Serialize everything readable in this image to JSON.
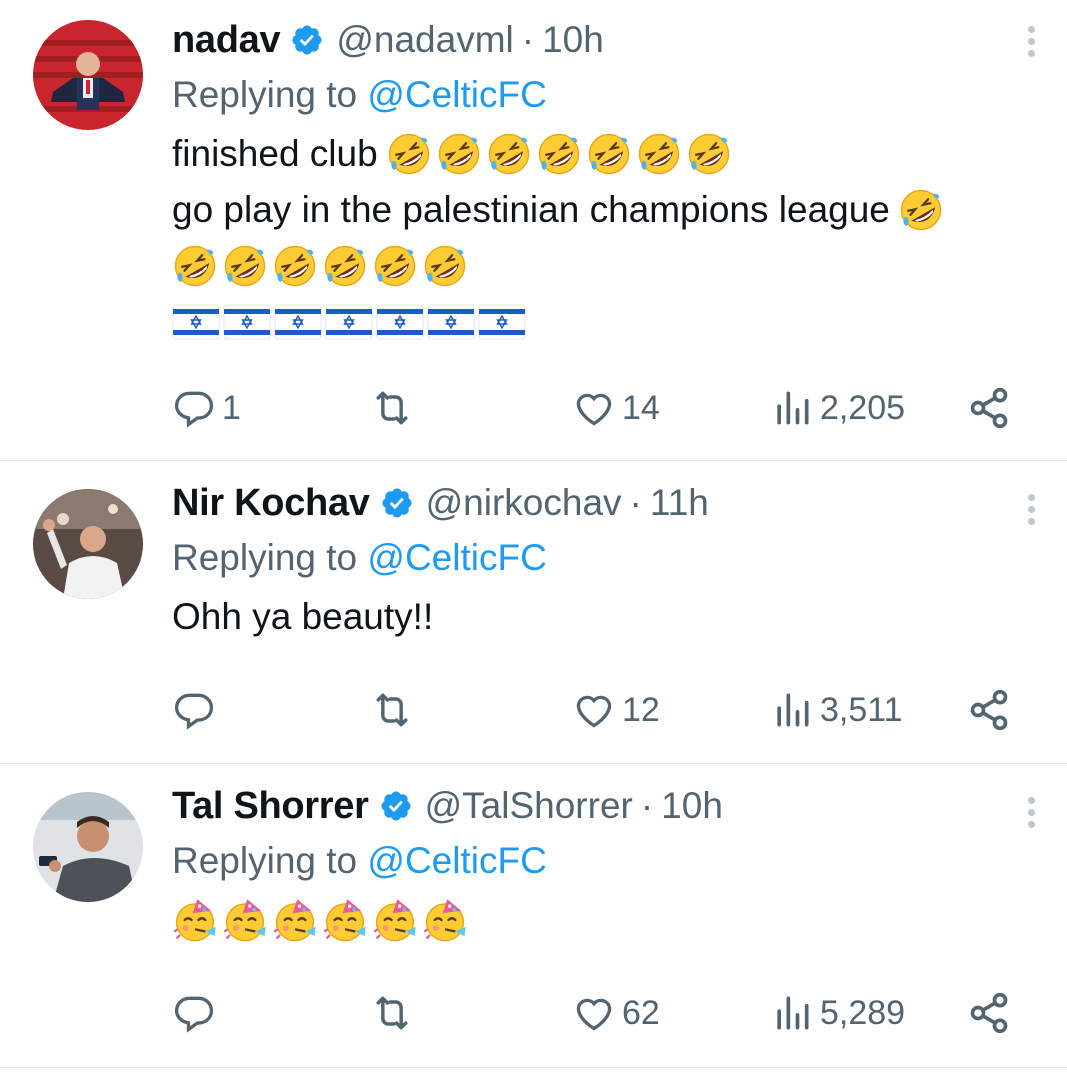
{
  "tweets": [
    {
      "name": "nadav",
      "handle": "@nadavml",
      "separator": "·",
      "time": "10h",
      "reply_prefix": "Replying to",
      "reply_mention": "@CelticFC",
      "text_lines": [
        "finished club",
        "go play in the palestinian champions league"
      ],
      "emoji_line1": {
        "icon": "rofl-emoji",
        "count": 7
      },
      "emoji_line2_inline": {
        "icon": "rofl-emoji",
        "count": 1
      },
      "emoji_line3": {
        "icon": "rofl-emoji",
        "count": 6
      },
      "flag_line": {
        "icon": "israel-flag",
        "count": 7
      },
      "replies": "1",
      "retweets": "",
      "likes": "14",
      "views": "2,205"
    },
    {
      "name": "Nir Kochav",
      "handle": "@nirkochav",
      "separator": "·",
      "time": "11h",
      "reply_prefix": "Replying to",
      "reply_mention": "@CelticFC",
      "text_lines": [
        "Ohh ya beauty!!"
      ],
      "replies": "",
      "retweets": "",
      "likes": "12",
      "views": "3,511"
    },
    {
      "name": "Tal Shorrer",
      "handle": "@TalShorrer",
      "separator": "·",
      "time": "10h",
      "reply_prefix": "Replying to",
      "reply_mention": "@CelticFC",
      "emoji_line1": {
        "icon": "partying-face-emoji",
        "count": 6
      },
      "replies": "",
      "retweets": "",
      "likes": "62",
      "views": "5,289"
    }
  ],
  "colors": {
    "text": "#0f1419",
    "secondary": "#536471",
    "link": "#1d9bf0",
    "verified": "#1d9bf0",
    "divider": "#e6e9ec"
  }
}
